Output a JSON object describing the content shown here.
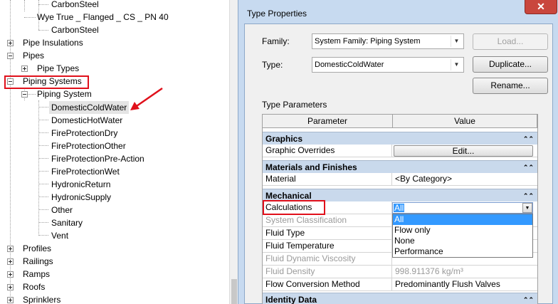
{
  "tree": {
    "items": [
      {
        "label": "CarbonSteel"
      },
      {
        "label": "Wye True _ Flanged _ CS _ PN 40"
      },
      {
        "label": "CarbonSteel"
      },
      {
        "label": "Pipe Insulations"
      },
      {
        "label": "Pipes"
      },
      {
        "label": "Pipe Types"
      },
      {
        "label": "Piping Systems"
      },
      {
        "label": "Piping System"
      },
      {
        "label": "DomesticColdWater"
      },
      {
        "label": "DomesticHotWater"
      },
      {
        "label": "FireProtectionDry"
      },
      {
        "label": "FireProtectionOther"
      },
      {
        "label": "FireProtectionPre-Action"
      },
      {
        "label": "FireProtectionWet"
      },
      {
        "label": "HydronicReturn"
      },
      {
        "label": "HydronicSupply"
      },
      {
        "label": "Other"
      },
      {
        "label": "Sanitary"
      },
      {
        "label": "Vent"
      },
      {
        "label": "Profiles"
      },
      {
        "label": "Railings"
      },
      {
        "label": "Ramps"
      },
      {
        "label": "Roofs"
      },
      {
        "label": "Sprinklers"
      }
    ]
  },
  "dialog": {
    "title": "Type Properties",
    "close_glyph": "✕",
    "family_label": "Family:",
    "family_value": "System Family: Piping System",
    "type_label": "Type:",
    "type_value": "DomesticColdWater",
    "load_button": "Load...",
    "duplicate_button": "Duplicate...",
    "rename_button": "Rename...",
    "type_parameters_label": "Type Parameters",
    "grid": {
      "col_parameter": "Parameter",
      "col_value": "Value",
      "collapse_glyph": "⌃⌃",
      "groups": {
        "graphics": "Graphics",
        "materials": "Materials and Finishes",
        "mechanical": "Mechanical",
        "identity": "Identity Data"
      },
      "rows": {
        "graphic_overrides": {
          "param": "Graphic Overrides",
          "value": "Edit..."
        },
        "material": {
          "param": "Material",
          "value": "<By Category>"
        },
        "calculations": {
          "param": "Calculations",
          "value": "All"
        },
        "system_classification": {
          "param": "System Classification",
          "value": ""
        },
        "fluid_type": {
          "param": "Fluid Type",
          "value": ""
        },
        "fluid_temperature": {
          "param": "Fluid Temperature",
          "value": ""
        },
        "fluid_dynamic_viscosity": {
          "param": "Fluid Dynamic Viscosity",
          "value": ""
        },
        "fluid_density": {
          "param": "Fluid Density",
          "value": "998.911376 kg/m³"
        },
        "flow_conversion_method": {
          "param": "Flow Conversion Method",
          "value": "Predominantly Flush Valves"
        }
      },
      "calculations_options": [
        "All",
        "Flow only",
        "None",
        "Performance"
      ]
    }
  },
  "annotation_color": "#e0101b",
  "selection_color": "#3399ff"
}
